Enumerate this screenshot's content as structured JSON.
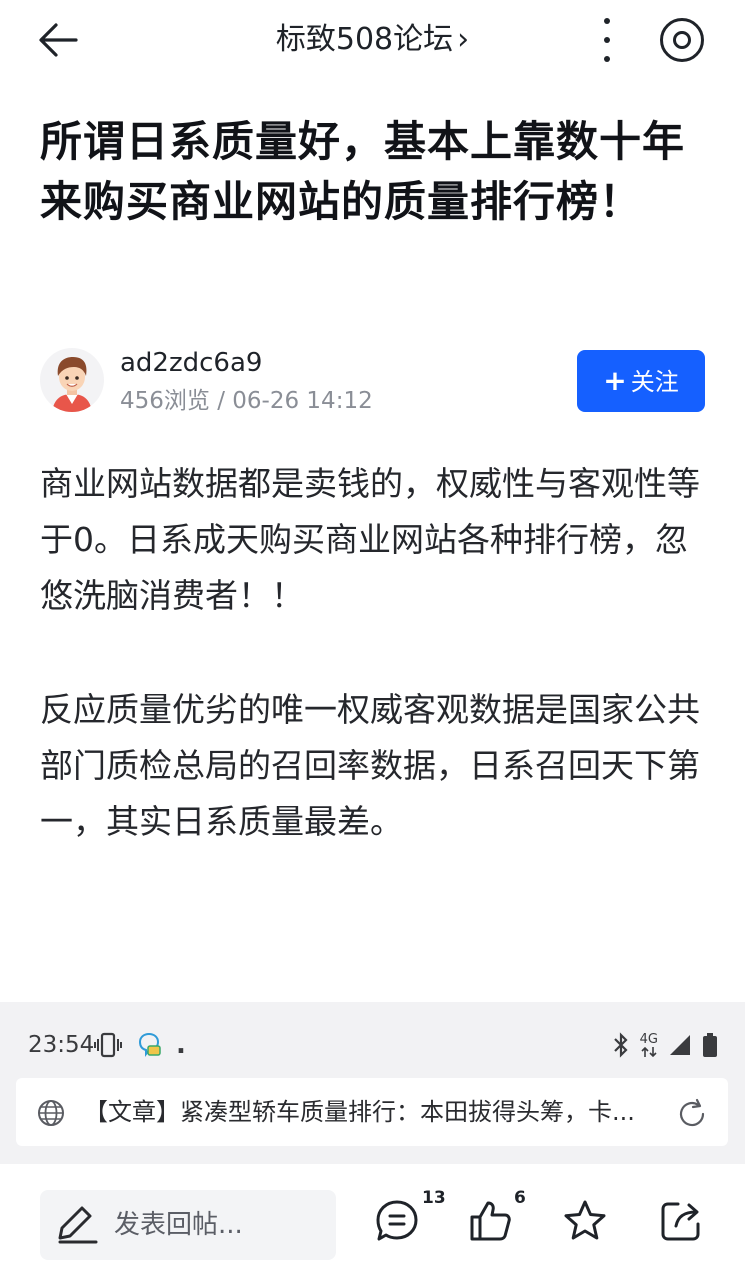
{
  "header": {
    "forum_name": "标致508论坛",
    "forum_chevron": "›"
  },
  "post": {
    "title": "所谓日系质量好，基本上靠数十年来购买商业网站的质量排行榜！",
    "author": {
      "name": "ad2zdc6a9",
      "views": "456浏览",
      "separator": " / ",
      "datetime": "06-26 14:12"
    },
    "follow_plus": "+",
    "follow_label": "关注",
    "paragraphs": [
      "商业网站数据都是卖钱的，权威性与客观性等于0。日系成天购买商业网站各种排行榜，忽悠洗脑消费者！！",
      "反应质量优劣的唯一权威客观数据是国家公共部门质检总局的召回率数据，日系召回天下第一，其实日系质量最差。"
    ]
  },
  "status_bar": {
    "time": "23:54",
    "dot": ".",
    "network": "4G"
  },
  "url_bar": {
    "text": "【文章】紧凑型轿车质量排行：本田拔得头筹，卡..."
  },
  "bottom_bar": {
    "reply_placeholder": "发表回帖...",
    "comment_count": "13",
    "like_count": "6"
  },
  "colors": {
    "accent": "#1560ff",
    "text": "#1f2329",
    "muted": "#8a8e96"
  }
}
